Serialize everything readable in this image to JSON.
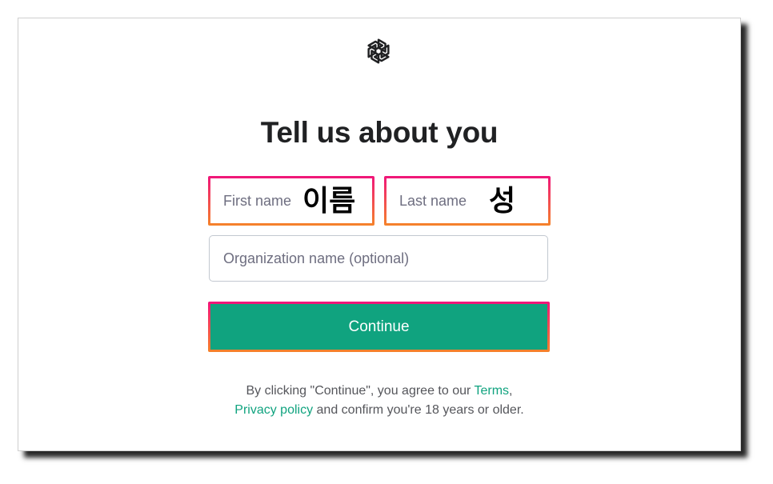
{
  "page": {
    "title": "Tell us about you"
  },
  "form": {
    "first_name": {
      "placeholder": "First name",
      "annotation": "이름"
    },
    "last_name": {
      "placeholder": "Last name",
      "annotation": "성"
    },
    "organization": {
      "placeholder": "Organization name (optional)"
    },
    "continue_label": "Continue"
  },
  "legal": {
    "prefix": "By clicking \"Continue\", you agree to our ",
    "terms_link": "Terms",
    "comma": ",",
    "privacy_link": "Privacy policy",
    "suffix": " and confirm you're 18 years or older."
  },
  "icons": {
    "logo": "openai-logo-icon"
  },
  "colors": {
    "accent": "#10a37f",
    "highlight_top": "#f0157a",
    "highlight_bottom": "#f5832a",
    "title_text": "#202123",
    "placeholder_text": "#6e6e80",
    "border": "#c2c8d0"
  }
}
